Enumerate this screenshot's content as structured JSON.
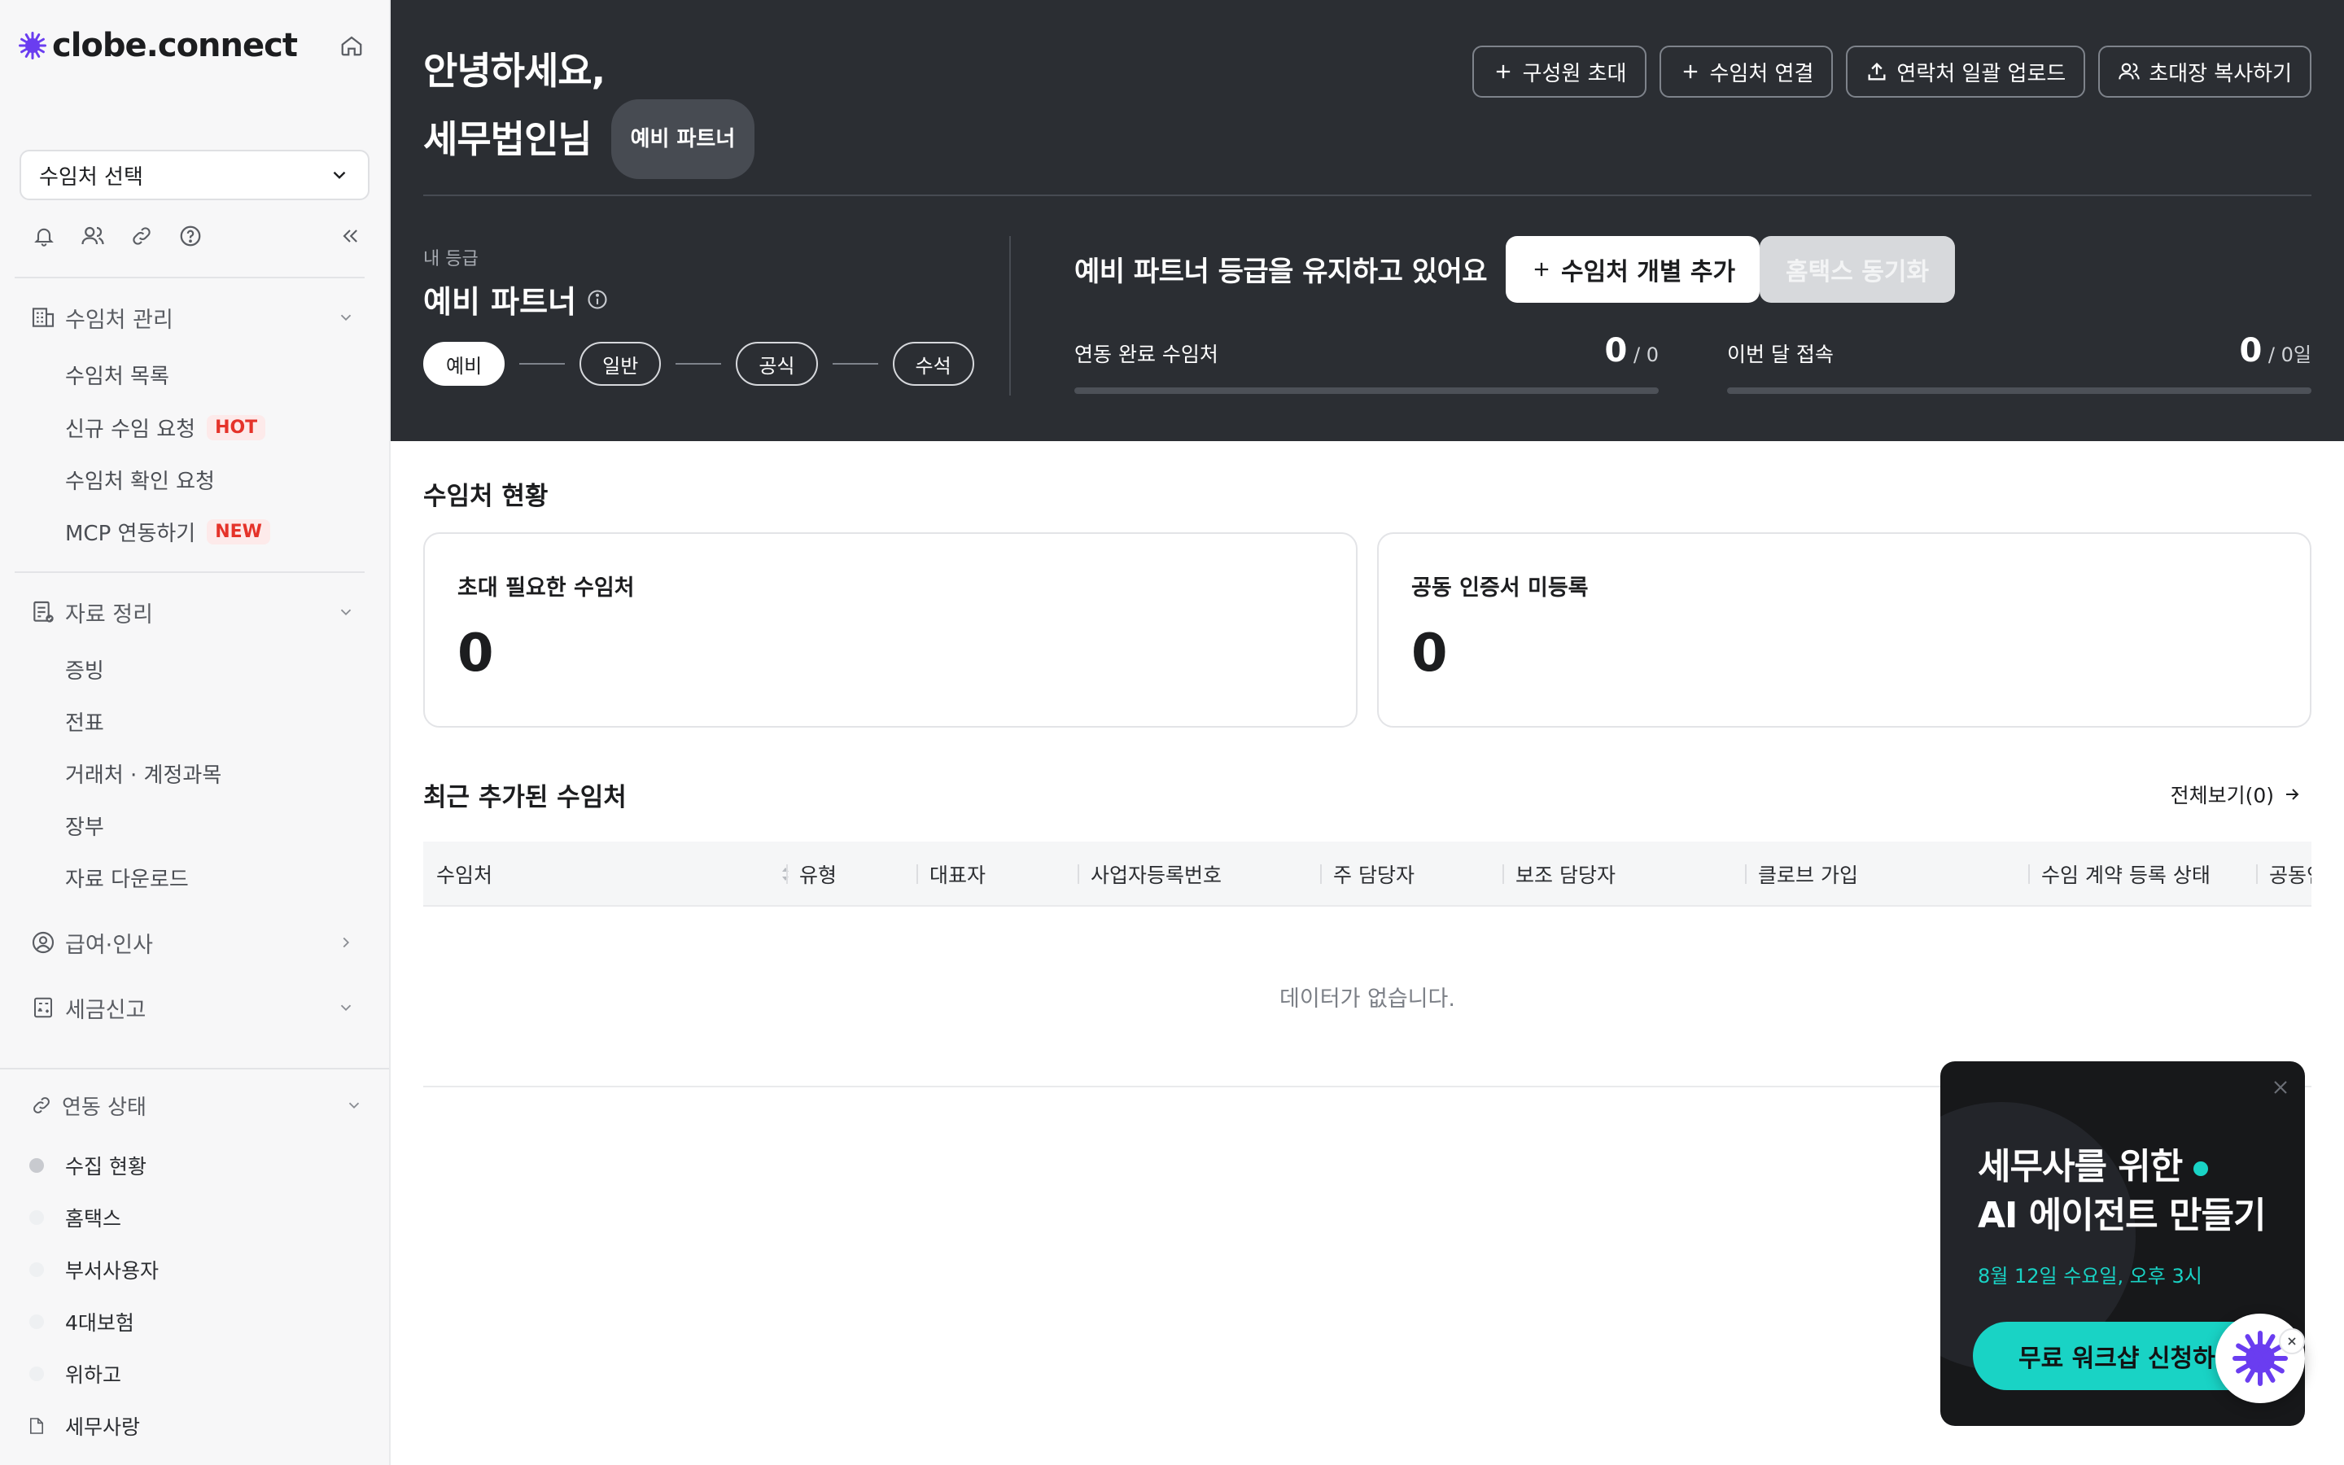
{
  "brand": {
    "name": "clobe.connect"
  },
  "sidebar": {
    "client_select": "수임처 선택",
    "sections": {
      "client_mgmt": {
        "label": "수임처 관리",
        "items": [
          {
            "label": "수임처 목록"
          },
          {
            "label": "신규 수임 요청",
            "tag": "HOT"
          },
          {
            "label": "수임처 확인 요청"
          },
          {
            "label": "MCP 연동하기",
            "tag": "NEW"
          }
        ]
      },
      "data_org": {
        "label": "자료 정리",
        "items": [
          {
            "label": "증빙"
          },
          {
            "label": "전표"
          },
          {
            "label": "거래처 · 계정과목"
          },
          {
            "label": "장부"
          },
          {
            "label": "자료 다운로드"
          }
        ]
      },
      "payroll": {
        "label": "급여·인사"
      },
      "tax": {
        "label": "세금신고"
      }
    },
    "link_status": {
      "label": "연동 상태",
      "items": [
        {
          "label": "수집 현황"
        },
        {
          "label": "홈택스"
        },
        {
          "label": "부서사용자"
        },
        {
          "label": "4대보험"
        },
        {
          "label": "위하고"
        },
        {
          "label": "세무사랑"
        }
      ]
    }
  },
  "header": {
    "greeting_line1": "안녕하세요,",
    "greeting_line2": "세무법인님",
    "badge": "예비 파트너",
    "actions": {
      "invite_member": "구성원 초대",
      "connect_client": "수임처 연결",
      "bulk_upload": "연락처 일괄 업로드",
      "copy_invite": "초대장 복사하기"
    },
    "grade_label": "내 등급",
    "grade_name": "예비 파트너",
    "steps": [
      "예비",
      "일반",
      "공식",
      "수석"
    ],
    "keep_message": "예비 파트너 등급을 유지하고 있어요",
    "add_client": "수임처 개별 추가",
    "sync_hometax": "홈택스 동기화",
    "metric_linked": {
      "label": "연동 완료 수임처",
      "value": "0",
      "total": " / 0"
    },
    "metric_visits": {
      "label": "이번 달 접속",
      "value": "0",
      "total": " / 0일"
    }
  },
  "main": {
    "status_title": "수임처 현황",
    "cards": [
      {
        "title": "초대 필요한 수임처",
        "value": "0"
      },
      {
        "title": "공동 인증서 미등록",
        "value": "0"
      }
    ],
    "recent_title": "최근 추가된 수임처",
    "view_all": "전체보기(0)",
    "table": {
      "columns": [
        "수임처",
        "유형",
        "대표자",
        "사업자등록번호",
        "주 담당자",
        "보조 담당자",
        "클로브 가입",
        "수임 계약 등록 상태",
        "공동인"
      ],
      "empty": "데이터가 없습니다."
    }
  },
  "promo": {
    "title_line1": "세무사를 위한",
    "title_line2": "AI 에이전트 만들기",
    "date": "8월 12일 수요일, 오후 3시",
    "cta": "무료 워크샵 신청하기"
  },
  "colors": {
    "header_bg": "#2b2e33",
    "accent": "#19d3c5",
    "hot": "#e5332a"
  }
}
